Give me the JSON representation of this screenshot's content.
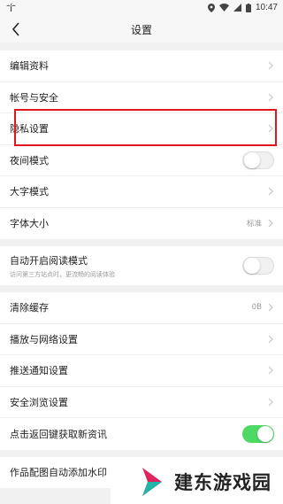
{
  "status_bar": {
    "time": "10:47"
  },
  "header": {
    "title": "设置"
  },
  "groups": [
    {
      "items": [
        {
          "label": "编辑资料"
        },
        {
          "label": "帐号与安全"
        },
        {
          "label": "隐私设置"
        },
        {
          "label": "夜间模式",
          "toggle": "off"
        },
        {
          "label": "大字模式"
        },
        {
          "label": "字体大小",
          "value": "标准"
        }
      ]
    },
    {
      "items": [
        {
          "label": "自动开启阅读模式",
          "sub": "访问第三方站点时，更流畅的阅读体验",
          "toggle": "off"
        }
      ]
    },
    {
      "items": [
        {
          "label": "清除缓存",
          "value": "0B"
        },
        {
          "label": "播放与网络设置"
        },
        {
          "label": "推送通知设置"
        },
        {
          "label": "安全浏览设置"
        },
        {
          "label": "点击返回键获取新资讯",
          "toggle": "on"
        }
      ]
    },
    {
      "items": [
        {
          "label": "作品配图自动添加水印"
        }
      ]
    }
  ],
  "watermark": {
    "text": "建东游戏园"
  },
  "colors": {
    "toggle_on": "#4cd964",
    "highlight": "#e3161d"
  }
}
